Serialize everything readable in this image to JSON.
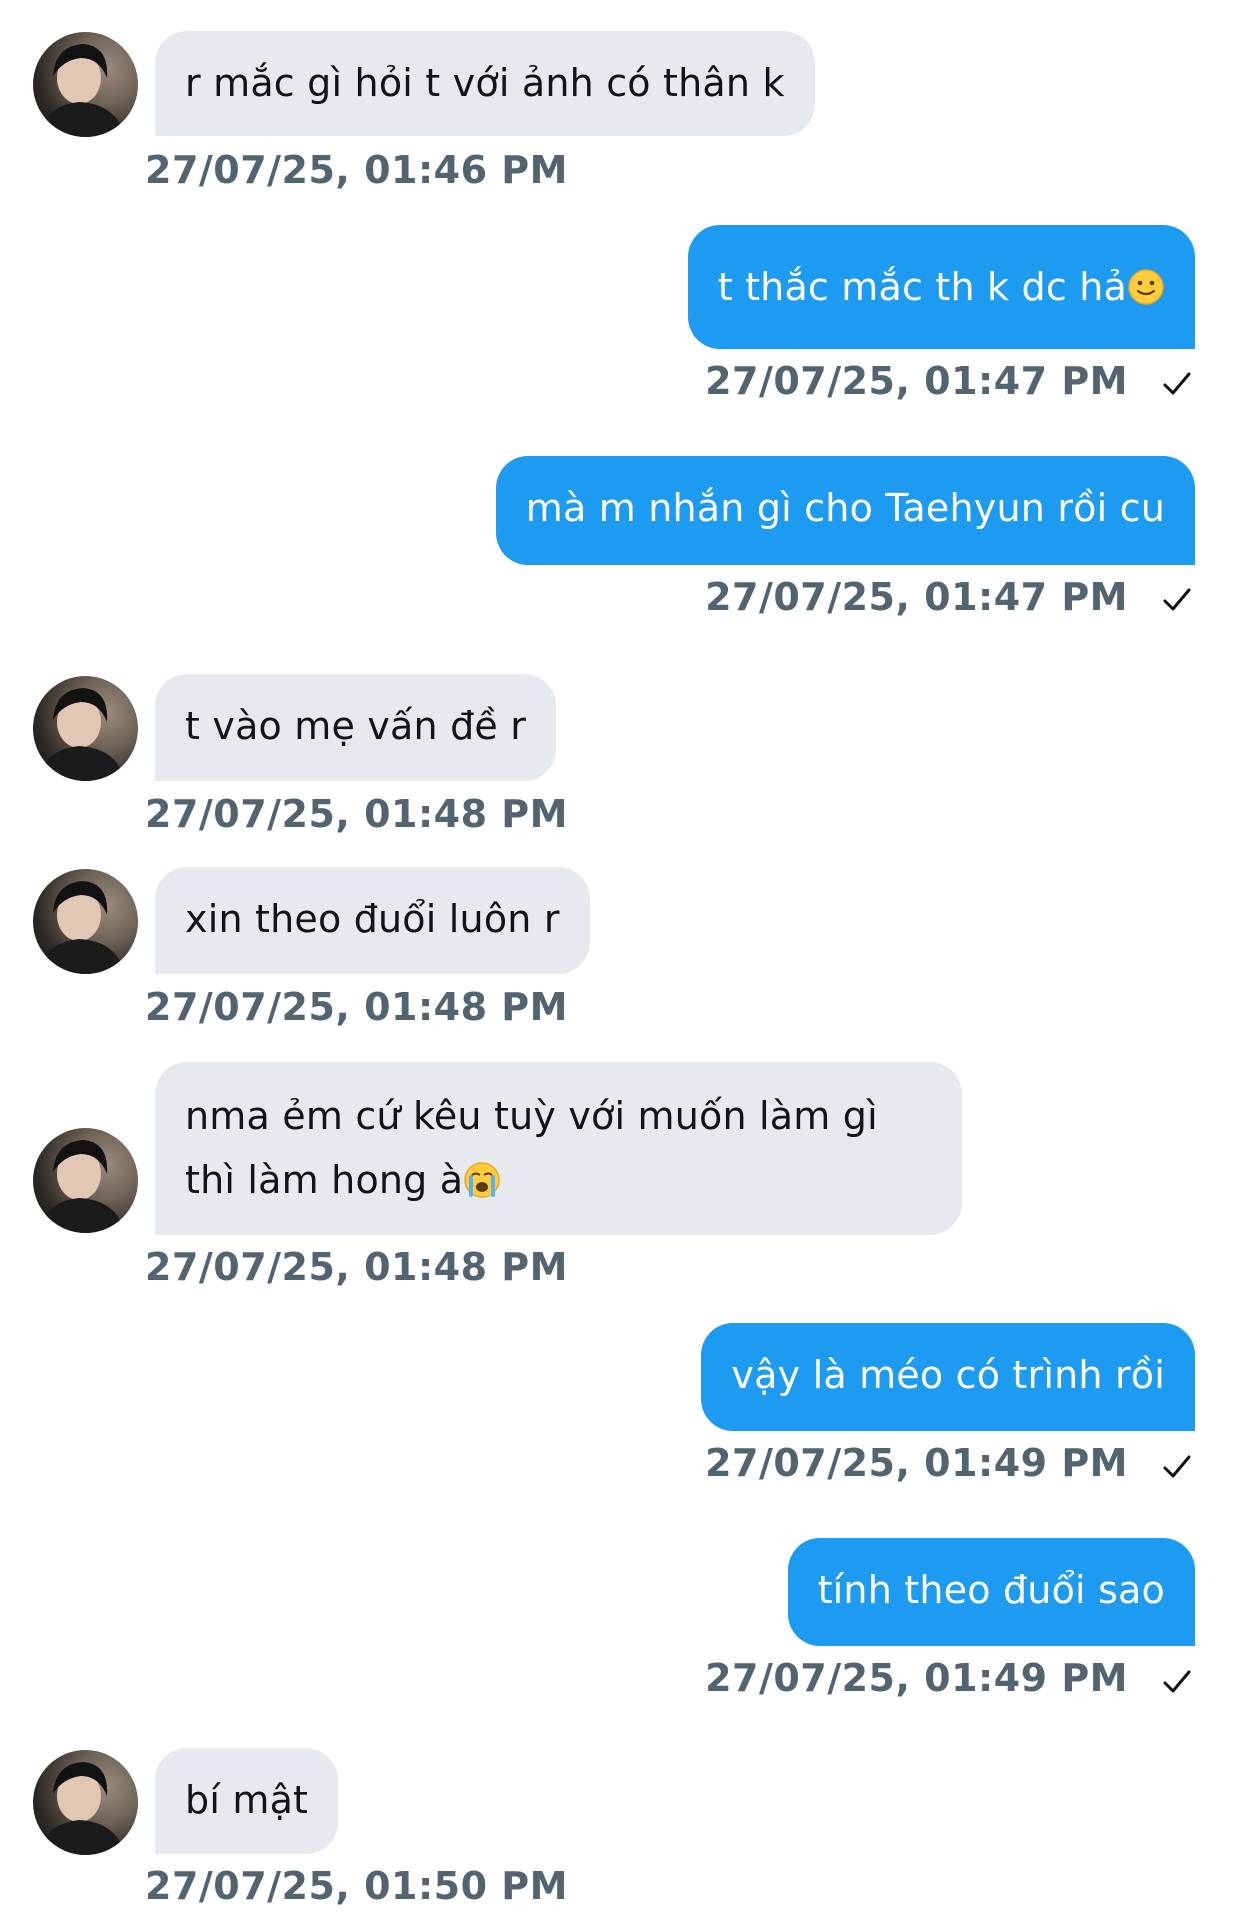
{
  "messages": [
    {
      "side": "in",
      "text": "r mắc gì hỏi t với ảnh có thân k",
      "timestamp": "27/07/25, 01:46 PM"
    },
    {
      "side": "out",
      "text": "t thắc mắc th k dc hả",
      "emoji": "slightly-smiling-face",
      "timestamp": "27/07/25, 01:47 PM",
      "status": "sent-check"
    },
    {
      "side": "out",
      "text": "mà m nhắn gì cho Taehyun rồi cu",
      "timestamp": "27/07/25, 01:47 PM",
      "status": "sent-check"
    },
    {
      "side": "in",
      "text": "t vào mẹ vấn đề r",
      "timestamp": "27/07/25, 01:48 PM"
    },
    {
      "side": "in",
      "text": "xin theo đuổi luôn r",
      "timestamp": "27/07/25, 01:48 PM"
    },
    {
      "side": "in",
      "text_line1": "nma ẻm cứ kêu tuỳ với muốn làm gì",
      "text_line2": "thì làm hong à",
      "emoji": "loudly-crying-face",
      "timestamp": "27/07/25, 01:48 PM"
    },
    {
      "side": "out",
      "text": "vậy là méo có trình rồi",
      "timestamp": "27/07/25, 01:49 PM",
      "status": "sent-check"
    },
    {
      "side": "out",
      "text": "tính theo đuổi sao",
      "timestamp": "27/07/25, 01:49 PM",
      "status": "sent-check"
    },
    {
      "side": "in",
      "text": "bí mật",
      "timestamp": "27/07/25, 01:50 PM"
    }
  ],
  "colors": {
    "outgoing_bubble": "#1d9bf0",
    "incoming_bubble": "#e6e9ed",
    "timestamp": "#536471"
  },
  "icons": {
    "avatar": "contact-avatar",
    "status": "check-icon"
  }
}
